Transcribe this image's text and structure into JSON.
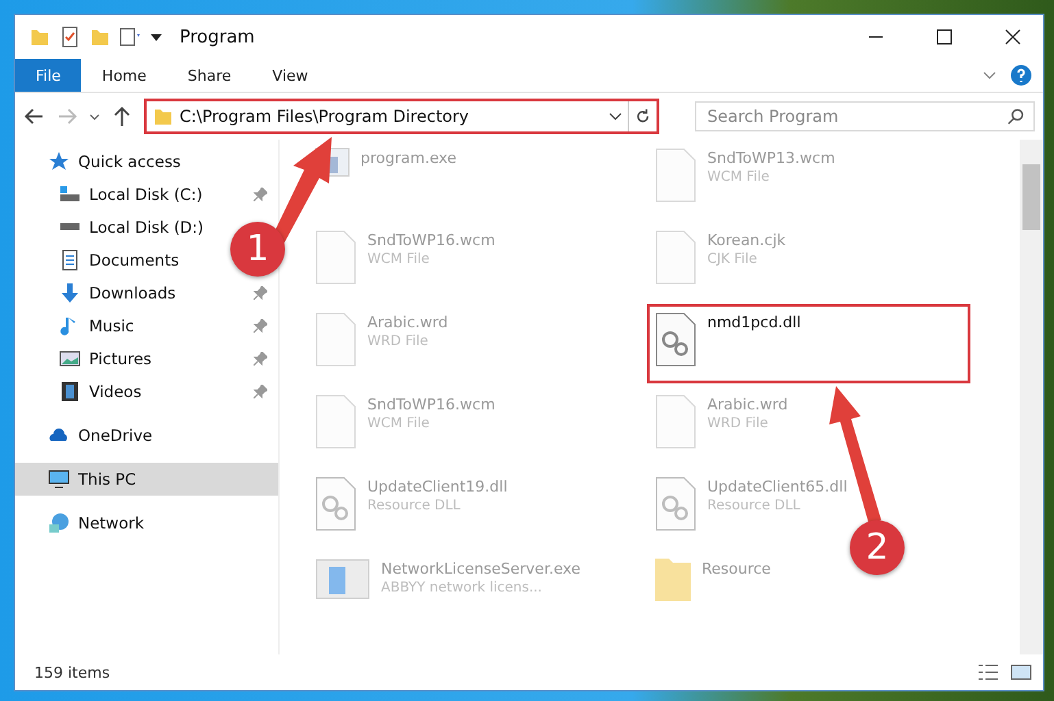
{
  "window": {
    "title": "Program"
  },
  "ribbon_tabs": [
    {
      "label": "File",
      "selected": true
    },
    {
      "label": "Home",
      "selected": false
    },
    {
      "label": "Share",
      "selected": false
    },
    {
      "label": "View",
      "selected": false
    }
  ],
  "address_bar": {
    "value": "C:\\Program Files\\Program Directory",
    "highlighted": true
  },
  "search": {
    "placeholder": "Search Program"
  },
  "sidebar": {
    "items": [
      {
        "label": "Quick access",
        "selected": false,
        "children": [
          {
            "label": "Local Disk (C:)",
            "pinned": true,
            "selected": false
          },
          {
            "label": "Local Disk (D:)",
            "selected": false
          },
          {
            "label": "Documents",
            "selected": false
          },
          {
            "label": "Downloads",
            "pinned": true,
            "selected": false
          },
          {
            "label": "Music",
            "pinned": true,
            "selected": false
          },
          {
            "label": "Pictures",
            "pinned": true,
            "selected": false
          },
          {
            "label": "Videos",
            "pinned": true,
            "selected": false
          }
        ]
      },
      {
        "label": "OneDrive",
        "selected": false
      },
      {
        "label": "This PC",
        "selected": true
      },
      {
        "label": "Network",
        "selected": false
      }
    ]
  },
  "files": [
    {
      "name": "program.exe",
      "kind": "app",
      "faded": true,
      "highlighted": false
    },
    {
      "name": "SndToWP13.wcm",
      "type": "WCM File",
      "kind": "file",
      "faded": true,
      "highlighted": false
    },
    {
      "name": "SndToWP16.wcm",
      "type": "WCM File",
      "kind": "file",
      "faded": true,
      "highlighted": false
    },
    {
      "name": "Korean.cjk",
      "type": "CJK File",
      "kind": "file",
      "faded": true,
      "highlighted": false
    },
    {
      "name": "Arabic.wrd",
      "type": "WRD File",
      "kind": "file",
      "faded": true,
      "highlighted": false
    },
    {
      "name": "nmd1pcd.dll",
      "kind": "dll",
      "faded": false,
      "highlighted": true
    },
    {
      "name": "SndToWP16.wcm",
      "type": "WCM File",
      "kind": "file",
      "faded": true,
      "highlighted": false
    },
    {
      "name": "Arabic.wrd",
      "type": "WRD File",
      "kind": "file",
      "faded": true,
      "highlighted": false
    },
    {
      "name": "UpdateClient19.dll",
      "type": "Resource DLL",
      "kind": "dll",
      "faded": true,
      "highlighted": false
    },
    {
      "name": "UpdateClient65.dll",
      "type": "Resource DLL",
      "kind": "dll",
      "faded": true,
      "highlighted": false
    },
    {
      "name": "NetworkLicenseServer.exe",
      "type": "ABBYY network licens...",
      "kind": "exe",
      "faded": true,
      "highlighted": false
    },
    {
      "name": "Resource",
      "kind": "folder",
      "faded": true,
      "highlighted": false
    }
  ],
  "callouts": [
    {
      "number": "1"
    },
    {
      "number": "2"
    }
  ],
  "status_bar": {
    "count": "159 items"
  }
}
